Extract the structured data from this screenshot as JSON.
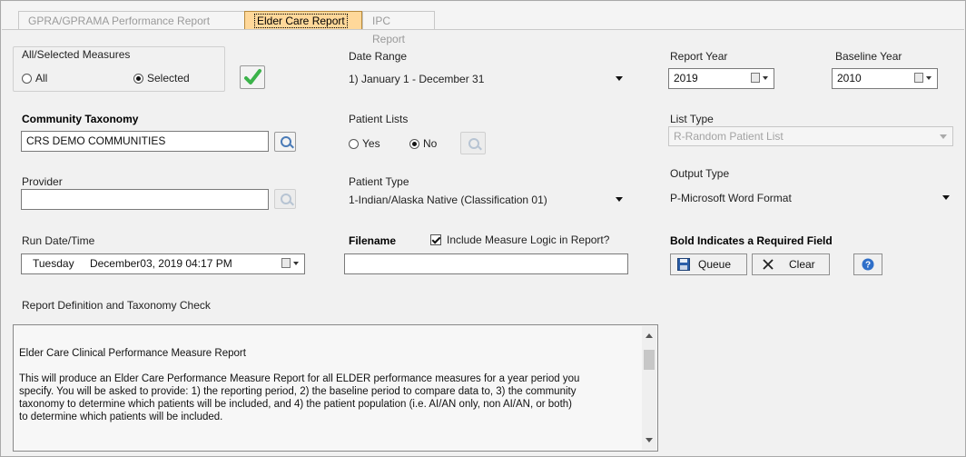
{
  "tabs": [
    {
      "label": "GPRA/GPRAMA Performance Report",
      "active": false
    },
    {
      "label": "Elder Care Report",
      "active": true
    },
    {
      "label": "IPC Report",
      "active": false
    }
  ],
  "measures": {
    "title": "All/Selected Measures",
    "option_all": "All",
    "option_selected": "Selected",
    "selected": "Selected"
  },
  "date_range": {
    "label": "Date Range",
    "value": "1) January 1 - December 31"
  },
  "report_year": {
    "label": "Report Year",
    "value": "2019"
  },
  "baseline_year": {
    "label": "Baseline Year",
    "value": "2010"
  },
  "community_taxonomy": {
    "label": "Community Taxonomy",
    "value": "CRS DEMO COMMUNITIES"
  },
  "patient_lists": {
    "label": "Patient Lists",
    "option_yes": "Yes",
    "option_no": "No",
    "selected": "No"
  },
  "list_type": {
    "label": "List Type",
    "value": "R-Random Patient List"
  },
  "provider": {
    "label": "Provider",
    "value": ""
  },
  "patient_type": {
    "label": "Patient Type",
    "value": "1-Indian/Alaska Native (Classification 01)"
  },
  "output_type": {
    "label": "Output Type",
    "value": "P-Microsoft Word Format"
  },
  "run_datetime": {
    "label": "Run Date/Time",
    "day": "Tuesday",
    "value": "December03, 2019  04:17 PM"
  },
  "filename": {
    "label": "Filename",
    "value": ""
  },
  "include_logic": {
    "label": "Include Measure Logic in Report?",
    "checked": true
  },
  "required_note": "Bold Indicates a Required Field",
  "buttons": {
    "queue": "Queue",
    "clear": "Clear"
  },
  "report_definition": {
    "label": "Report Definition and Taxonomy Check",
    "heading": "Elder Care Clinical Performance Measure Report",
    "lines": [
      "This will produce an Elder Care Performance Measure Report for all ELDER performance measures for a year period you",
      "specify.  You will be asked to provide: 1) the reporting period, 2) the baseline period to compare data to, 3) the community",
      "taxonomy to determine which patients will be included, and 4) the patient population (i.e. AI/AN only, non AI/AN, or both)",
      "to determine which patients will be included."
    ]
  },
  "icons": {
    "search": "magnifier-icon",
    "calendar": "calendar-icon",
    "check": "green-checkmark-icon",
    "save": "floppy-disk-icon",
    "clear": "x-icon",
    "help": "help-icon"
  },
  "colors": {
    "active_tab": "#ffd89a",
    "check": "#3bb34a",
    "help": "#2f6fc9"
  }
}
